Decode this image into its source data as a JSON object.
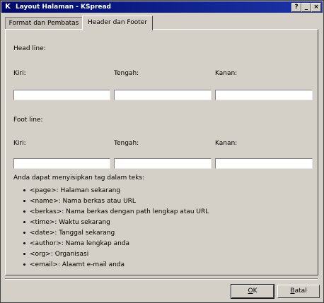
{
  "window": {
    "title": "Layout Halaman - KSpread",
    "app_icon": "K",
    "help_glyph": "?",
    "min_glyph": "_",
    "close_glyph": "×"
  },
  "tabs": [
    {
      "label": "Format dan Pembatas",
      "active": false
    },
    {
      "label": "Header dan Footer",
      "active": true
    }
  ],
  "head": {
    "section_label": "Head line:",
    "left_label": "Kiri:",
    "center_label": "Tengah:",
    "right_label": "Kanan:",
    "left_value": "",
    "center_value": "",
    "right_value": ""
  },
  "foot": {
    "section_label": "Foot line:",
    "left_label": "Kiri:",
    "center_label": "Tengah:",
    "right_label": "Kanan:",
    "left_value": "",
    "center_value": "",
    "right_value": ""
  },
  "tags": {
    "intro": "Anda dapat menyisipkan tag dalam teks:",
    "items": [
      "<page>: Halaman sekarang",
      "<name>: Nama berkas atau URL",
      "<berkas>: Nama berkas dengan path lengkap atau URL",
      "<time>: Waktu sekarang",
      "<date>: Tanggal sekarang",
      "<author>: Nama lengkap anda",
      "<org>: Organisasi",
      "<email>: Alaamt e-mail anda"
    ]
  },
  "buttons": {
    "ok_first": "O",
    "ok_rest": "K",
    "cancel_first": "B",
    "cancel_rest": "atal"
  }
}
